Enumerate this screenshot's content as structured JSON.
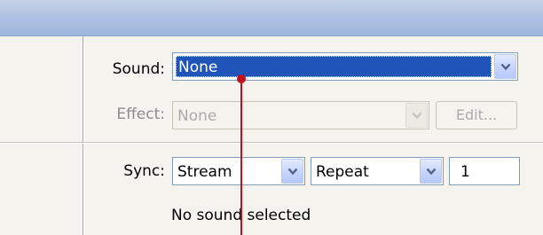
{
  "sound": {
    "label": "Sound:",
    "value": "None"
  },
  "effect": {
    "label": "Effect:",
    "value": "None",
    "edit_label": "Edit..."
  },
  "sync": {
    "label": "Sync:",
    "mode": "Stream",
    "loop": "Repeat",
    "count": "1"
  },
  "status_text": "No sound selected",
  "icons": {
    "dropdown_arrow": "chevron-down-icon"
  },
  "colors": {
    "selection": "#2054b8",
    "annotation": "#c0101a",
    "titlebar": "#adc1e2"
  }
}
